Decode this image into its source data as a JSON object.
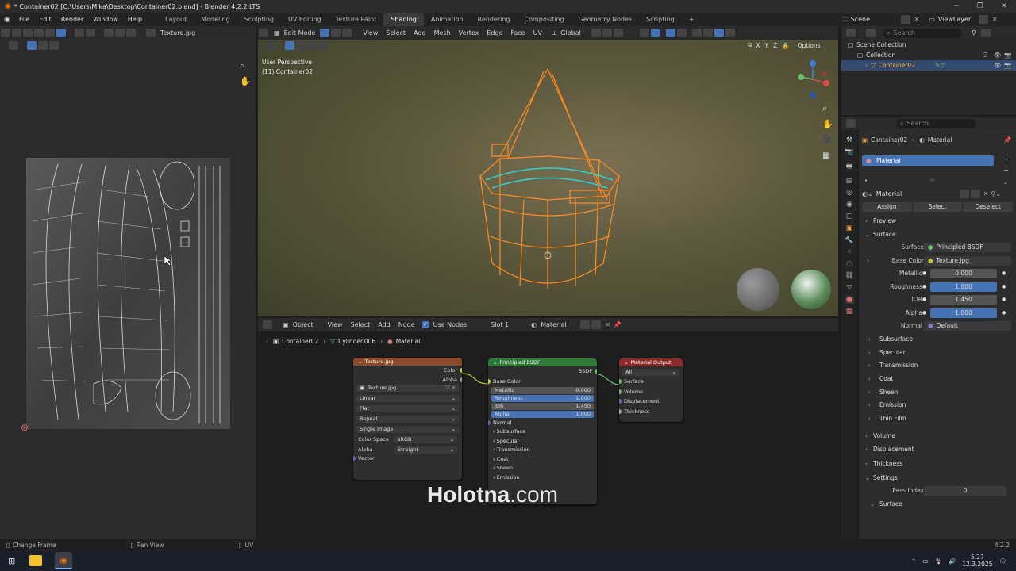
{
  "window": {
    "title": "* Container02 [C:\\Users\\Mika\\Desktop\\Container02.blend] - Blender 4.2.2 LTS"
  },
  "menus": [
    "File",
    "Edit",
    "Render",
    "Window",
    "Help"
  ],
  "workspaces": [
    {
      "label": "Layout",
      "active": false
    },
    {
      "label": "Modeling",
      "active": false
    },
    {
      "label": "Sculpting",
      "active": false
    },
    {
      "label": "UV Editing",
      "active": false
    },
    {
      "label": "Texture Paint",
      "active": false
    },
    {
      "label": "Shading",
      "active": true
    },
    {
      "label": "Animation",
      "active": false
    },
    {
      "label": "Rendering",
      "active": false
    },
    {
      "label": "Compositing",
      "active": false
    },
    {
      "label": "Geometry Nodes",
      "active": false
    },
    {
      "label": "Scripting",
      "active": false
    }
  ],
  "scene": {
    "label": "Scene",
    "view_layer": "ViewLayer"
  },
  "uv_editor": {
    "image_name": "Texture.jpg"
  },
  "viewport": {
    "mode": "Edit Mode",
    "menus": [
      "View",
      "Select",
      "Add",
      "Mesh",
      "Vertex",
      "Edge",
      "Face",
      "UV"
    ],
    "transform": "Global",
    "options": "Options",
    "overlay_line1": "User Perspective",
    "overlay_line2": "(11) Container02",
    "axes": [
      "X",
      "Y",
      "Z"
    ]
  },
  "node_editor": {
    "type": "Object",
    "menus": [
      "View",
      "Select",
      "Add",
      "Node"
    ],
    "use_nodes": "Use Nodes",
    "slot": "Slot 1",
    "material": "Material",
    "breadcrumb": [
      "Container02",
      "Cylinder.006",
      "Material"
    ]
  },
  "nodes": {
    "texture": {
      "title": "Texture.jpg",
      "outputs": [
        "Color",
        "Alpha"
      ],
      "image": "Texture.jpg",
      "interpolation": "Linear",
      "projection": "Flat",
      "extension": "Repeat",
      "source": "Single Image",
      "color_space_label": "Color Space",
      "color_space": "sRGB",
      "alpha_label": "Alpha",
      "alpha": "Straight",
      "vector": "Vector"
    },
    "bsdf": {
      "title": "Principled BSDF",
      "output": "BSDF",
      "base_color": "Base Color",
      "metallic": {
        "label": "Metallic",
        "value": "0.000"
      },
      "roughness": {
        "label": "Roughness",
        "value": "1.000"
      },
      "ior": {
        "label": "IOR",
        "value": "1.450"
      },
      "alpha": {
        "label": "Alpha",
        "value": "1.000"
      },
      "normal": "Normal",
      "panels": [
        "Subsurface",
        "Specular",
        "Transmission",
        "Coat",
        "Sheen",
        "Emission"
      ]
    },
    "output": {
      "title": "Material Output",
      "target": "All",
      "inputs": [
        "Surface",
        "Volume",
        "Displacement",
        "Thickness"
      ]
    }
  },
  "watermark": {
    "brand": "Holotna",
    "suffix": ".com"
  },
  "outliner": {
    "search_placeholder": "Search",
    "rows": [
      "Scene Collection",
      "Collection",
      "Container02"
    ]
  },
  "properties": {
    "search_placeholder": "Search",
    "breadcrumb": [
      "Container02",
      "Material"
    ],
    "slot": "Material",
    "material_name": "Material",
    "assign": "Assign",
    "select": "Select",
    "deselect": "Deselect",
    "preview": "Preview",
    "surface_section": "Surface",
    "surface": {
      "label": "Surface",
      "value": "Principled BSDF"
    },
    "base_color": {
      "label": "Base Color",
      "value": "Texture.jpg"
    },
    "metallic": {
      "label": "Metallic",
      "value": "0.000"
    },
    "roughness": {
      "label": "Roughness",
      "value": "1.000"
    },
    "ior": {
      "label": "IOR",
      "value": "1.450"
    },
    "alpha": {
      "label": "Alpha",
      "value": "1.000"
    },
    "normal": {
      "label": "Normal",
      "value": "Default"
    },
    "subsections": [
      "Subsurface",
      "Specular",
      "Transmission",
      "Coat",
      "Sheen",
      "Emission",
      "Thin Film"
    ],
    "volume": "Volume",
    "displacement": "Displacement",
    "thickness": "Thickness",
    "settings": "Settings",
    "pass_index": {
      "label": "Pass Index",
      "value": "0"
    },
    "surface_sub": "Surface"
  },
  "statusbar": {
    "left": "Change Frame",
    "middle": "Pan View",
    "right": "UV",
    "version": "4.2.2"
  },
  "taskbar": {
    "time": "5.27",
    "date": "12.3.2025"
  },
  "colors": {
    "accent": "#4772b3",
    "wire": "#ff8a1e",
    "seam": "#2fd0d0",
    "node_texture": "#8a4a2a",
    "node_shader": "#2e7a3a",
    "node_output": "#8a2a2a"
  }
}
